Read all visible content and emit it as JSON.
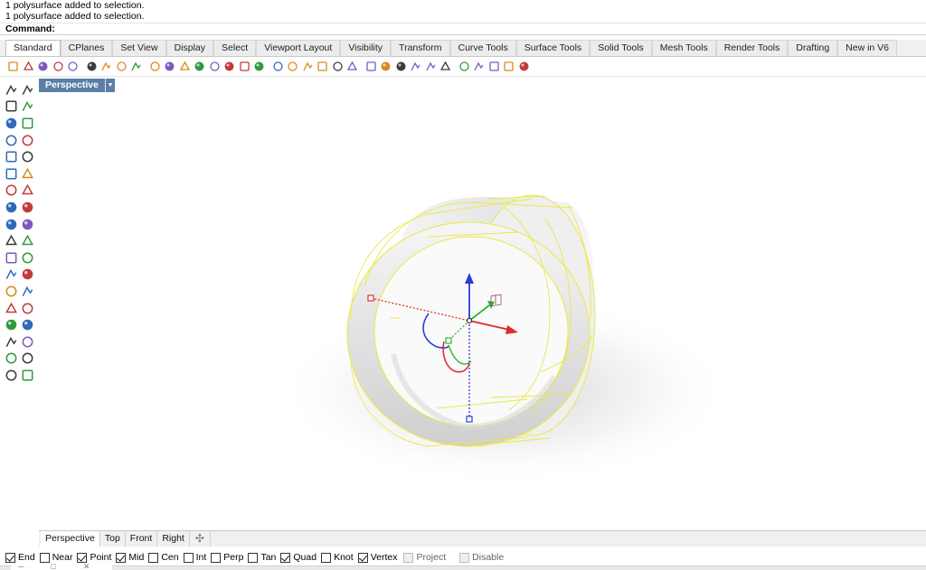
{
  "command_history": [
    "1 polysurface added to selection.",
    "1 polysurface added to selection."
  ],
  "command_prompt": {
    "label": "Command:",
    "value": ""
  },
  "tabs": [
    {
      "label": "Standard",
      "active": true
    },
    {
      "label": "CPlanes"
    },
    {
      "label": "Set View"
    },
    {
      "label": "Display"
    },
    {
      "label": "Select"
    },
    {
      "label": "Viewport Layout"
    },
    {
      "label": "Visibility"
    },
    {
      "label": "Transform"
    },
    {
      "label": "Curve Tools"
    },
    {
      "label": "Surface Tools"
    },
    {
      "label": "Solid Tools"
    },
    {
      "label": "Mesh Tools"
    },
    {
      "label": "Render Tools"
    },
    {
      "label": "Drafting"
    },
    {
      "label": "New in V6"
    }
  ],
  "toolbar_icons": [
    "new-file-icon",
    "open-file-icon",
    "save-icon",
    "print-icon",
    "import-icon",
    "cut-icon",
    "copy-icon",
    "paste-icon",
    "undo-icon",
    "pan-hand-icon",
    "move-icon",
    "zoom-icon",
    "zoom-window-icon",
    "zoom-extents-icon",
    "zoom-selected-icon",
    "rotate-view-icon",
    "four-viewports-icon",
    "car-icon",
    "eye-icon",
    "named-view-icon",
    "place-camera-icon",
    "light-icon",
    "lock-icon",
    "layer-icon",
    "color-wheel-icon",
    "render-sphere-icon",
    "render-preview-icon",
    "gray-sphere-icon",
    "blue-sphere-icon",
    "options-icon",
    "gear-icon",
    "grid-snap-icon",
    "globe-icon",
    "help-icon"
  ],
  "left_tools": [
    [
      "select-arrow-icon",
      "point-icon"
    ],
    [
      "polyline-icon",
      "curve-from-points-icon"
    ],
    [
      "circle-icon",
      "ellipse-icon"
    ],
    [
      "polygon-icon",
      "rectangle-icon"
    ],
    [
      "arc-icon",
      "fillet-curve-icon"
    ],
    [
      "surface-from-points-icon",
      "extrude-curve-icon"
    ],
    [
      "box-solid-icon",
      "sphere-solid-icon"
    ],
    [
      "cylinder-solid-icon",
      "mesh-icon"
    ],
    [
      "boolean-union-icon",
      "explode-icon"
    ],
    [
      "trim-icon",
      "split-icon"
    ],
    [
      "group-icon",
      "ungroup-icon"
    ],
    [
      "fillet-edge-icon",
      "offset-icon"
    ],
    [
      "text-icon",
      "dimension-icon"
    ],
    [
      "array-icon",
      "mirror-icon"
    ],
    [
      "solid-edit-icon",
      "measure-icon"
    ],
    [
      "grid-array-icon",
      "block-icon"
    ],
    [
      "analyze-icon",
      "check-icon"
    ],
    [
      "render-icon",
      "light-bulb-icon"
    ]
  ],
  "viewport": {
    "label": "Perspective",
    "menu_icon": "chevron-down-icon"
  },
  "view_tabs": [
    {
      "label": "Perspective",
      "active": true
    },
    {
      "label": "Top"
    },
    {
      "label": "Front"
    },
    {
      "label": "Right"
    }
  ],
  "osnaps": [
    {
      "label": "End",
      "checked": true
    },
    {
      "label": "Near",
      "checked": false
    },
    {
      "label": "Point",
      "checked": true
    },
    {
      "label": "Mid",
      "checked": true
    },
    {
      "label": "Cen",
      "checked": false
    },
    {
      "label": "Int",
      "checked": false
    },
    {
      "label": "Perp",
      "checked": false
    },
    {
      "label": "Tan",
      "checked": false
    },
    {
      "label": "Quad",
      "checked": true
    },
    {
      "label": "Knot",
      "checked": false
    },
    {
      "label": "Vertex",
      "checked": true
    },
    {
      "label": "Project",
      "checked": false,
      "disabled": true
    },
    {
      "label": "Disable",
      "checked": false,
      "disabled": true
    }
  ],
  "colors": {
    "viewport_tab": "#5b7fa5",
    "selection": "#f5f56a",
    "gumball_x": "#e32b2b",
    "gumball_y": "#2eb82e",
    "gumball_z": "#2b3fd6"
  }
}
